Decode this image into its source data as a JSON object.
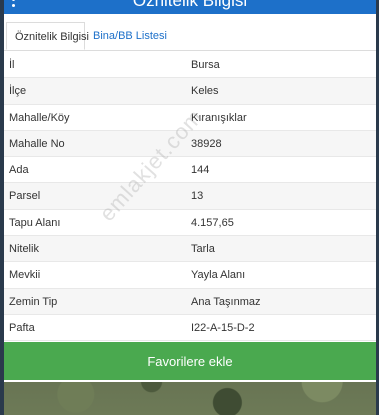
{
  "header": {
    "title": "Öznitelik Bilgisi",
    "menu_icon": "more-vertical-icon"
  },
  "tabs": [
    {
      "label": "Öznitelik Bilgisi",
      "active": true
    },
    {
      "label": "Bina/BB Listesi",
      "active": false
    }
  ],
  "rows": [
    {
      "key": "İl",
      "value": "Bursa"
    },
    {
      "key": "İlçe",
      "value": "Keles"
    },
    {
      "key": "Mahalle/Köy",
      "value": "Kıranışıklar"
    },
    {
      "key": "Mahalle No",
      "value": "38928"
    },
    {
      "key": "Ada",
      "value": "144"
    },
    {
      "key": "Parsel",
      "value": "13"
    },
    {
      "key": "Tapu Alanı",
      "value": "4.157,65"
    },
    {
      "key": "Nitelik",
      "value": "Tarla"
    },
    {
      "key": "Mevkii",
      "value": "Yayla Alanı"
    },
    {
      "key": "Zemin Tip",
      "value": "Ana Taşınmaz"
    },
    {
      "key": "Pafta",
      "value": "I22-A-15-D-2"
    }
  ],
  "watermark": "emlakjet.com",
  "actions": {
    "favorite_label": "Favorilere ekle"
  },
  "colors": {
    "header": "#1d70c9",
    "button": "#4aa94f",
    "link": "#1d70c9"
  }
}
